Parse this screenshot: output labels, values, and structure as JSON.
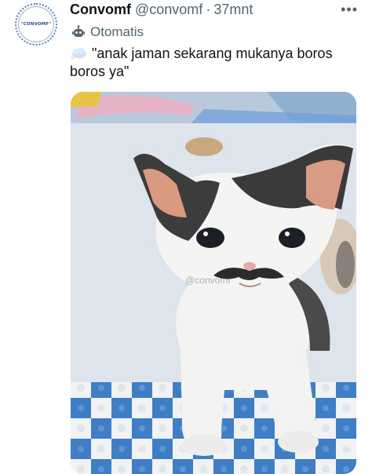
{
  "post": {
    "author_name": "Convomf",
    "avatar_text": "\"CONVOMF\"",
    "handle": "@convomf",
    "separator": "·",
    "time": "37mnt",
    "more_label": "•••",
    "automated_label": "Otomatis",
    "text_line1": "\"anak jaman sekarang mukanya boros",
    "text_line2": "boros ya\"",
    "icons": {
      "automated": "robot-icon",
      "emoji": "thought-cloud-emoji",
      "more": "more-icon"
    }
  },
  "media": {
    "watermark": "@convomf"
  },
  "colors": {
    "text": "#0f1419",
    "secondary": "#536471",
    "avatar_ring": "#5b7fae"
  }
}
